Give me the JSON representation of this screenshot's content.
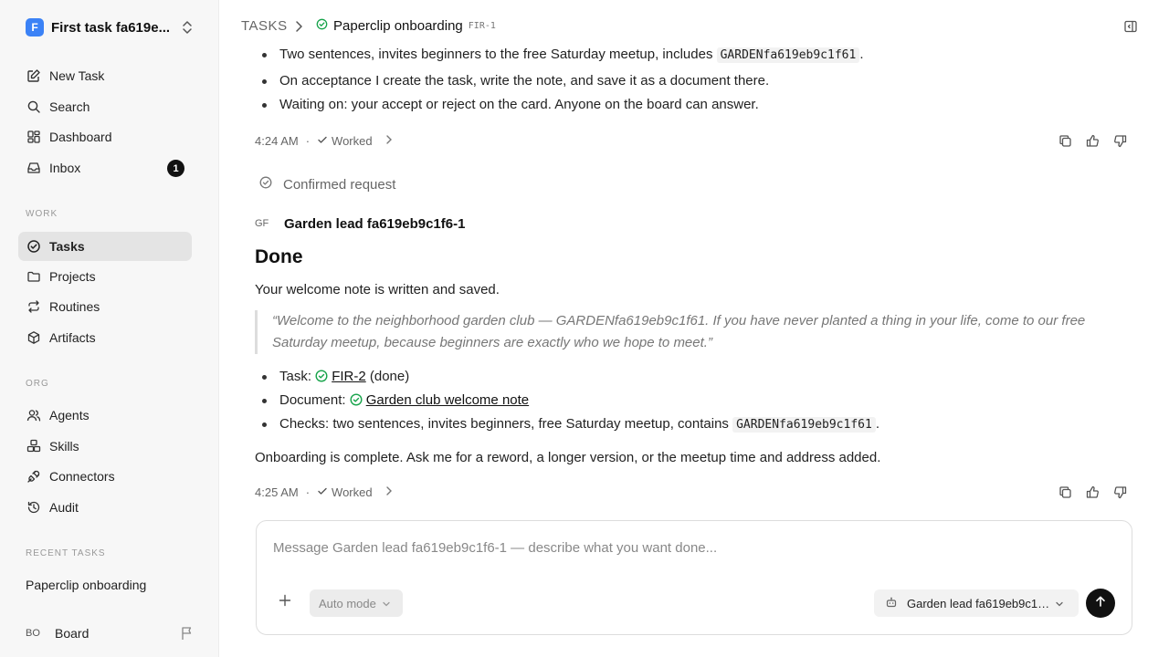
{
  "workspace": {
    "logo_letter": "F",
    "name": "First task fa619e..."
  },
  "nav": {
    "new_task": "New Task",
    "search": "Search",
    "dashboard": "Dashboard",
    "inbox": "Inbox",
    "inbox_count": "1"
  },
  "sections": {
    "work": "WORK",
    "org": "ORG",
    "recent": "RECENT TASKS"
  },
  "work_items": {
    "tasks": "Tasks",
    "projects": "Projects",
    "routines": "Routines",
    "artifacts": "Artifacts"
  },
  "org_items": {
    "agents": "Agents",
    "skills": "Skills",
    "connectors": "Connectors",
    "audit": "Audit"
  },
  "recent_tasks": [
    "Paperclip onboarding"
  ],
  "footer": {
    "initials": "BO",
    "name": "Board"
  },
  "breadcrumb": {
    "root": "TASKS",
    "task": "Paperclip onboarding",
    "task_id": "FIR-1"
  },
  "message1": {
    "bullet0_pre": "Two sentences, invites beginners to the free Saturday meetup, includes ",
    "bullet0_code": "GARDENfa619eb9c1f61",
    "bullet0_post": ".",
    "bullet1": "On acceptance I create the task, write the note, and save it as a document there.",
    "bullet2": "Waiting on: your accept or reject on the card. Anyone on the board can answer.",
    "time": "4:24 AM",
    "dot": "·",
    "status": "Worked"
  },
  "confirmed": "Confirmed request",
  "author": {
    "initials": "GF",
    "name": "Garden lead fa619eb9c1f6-1"
  },
  "message2": {
    "heading": "Done",
    "intro": "Your welcome note is written and saved.",
    "quote": "“Welcome to the neighborhood garden club — GARDENfa619eb9c1f61. If you have never planted a thing in your life, come to our free Saturday meetup, because beginners are exactly who we hope to meet.”",
    "task_label": "Task: ",
    "task_link": "FIR-2",
    "task_suffix": " (done)",
    "doc_label": "Document: ",
    "doc_link": "Garden club welcome note",
    "checks_pre": "Checks: two sentences, invites beginners, free Saturday meetup, contains ",
    "checks_code": "GARDENfa619eb9c1f61",
    "checks_post": ".",
    "outro": "Onboarding is complete. Ask me for a reword, a longer version, or the meetup time and address added.",
    "time": "4:25 AM",
    "dot": "·",
    "status": "Worked"
  },
  "composer": {
    "placeholder": "Message Garden lead fa619eb9c1f6-1 — describe what you want done...",
    "mode": "Auto mode",
    "agent": "Garden lead fa619eb9c1f6-1"
  },
  "colors": {
    "accent": "#3b82f6",
    "success": "#16a34a",
    "badge_bg": "#111111"
  }
}
